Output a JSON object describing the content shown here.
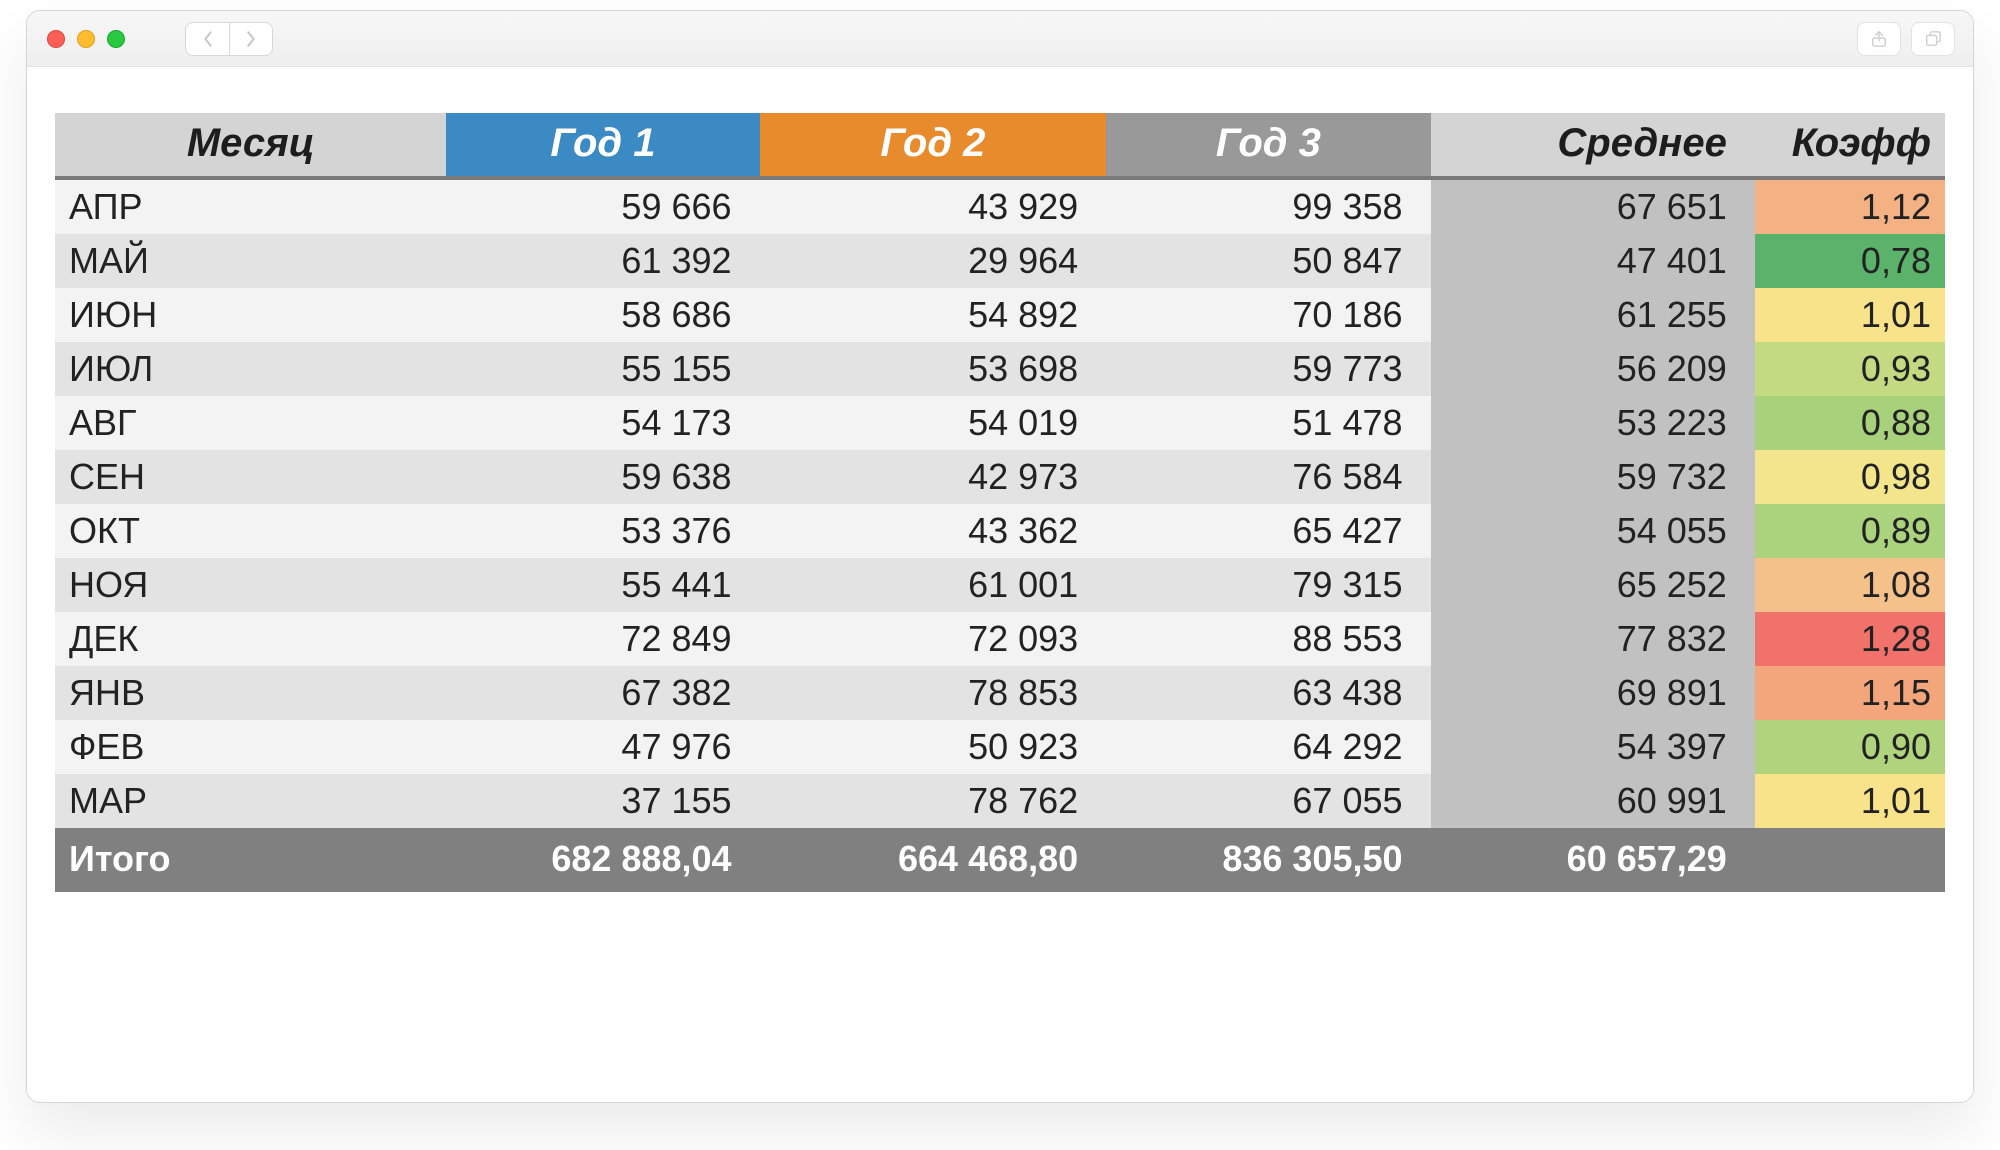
{
  "headers": {
    "month": "Месяц",
    "y1": "Год 1",
    "y2": "Год 2",
    "y3": "Год 3",
    "avg": "Среднее",
    "coef": "Коэфф"
  },
  "rows": [
    {
      "month": "АПР",
      "y1": "59 666",
      "y2": "43 929",
      "y3": "99 358",
      "avg": "67 651",
      "coef": "1,12",
      "coef_color": "#f4b183"
    },
    {
      "month": "МАЙ",
      "y1": "61 392",
      "y2": "29 964",
      "y3": "50 847",
      "avg": "47 401",
      "coef": "0,78",
      "coef_color": "#5bb26a"
    },
    {
      "month": "ИЮН",
      "y1": "58 686",
      "y2": "54 892",
      "y3": "70 186",
      "avg": "61 255",
      "coef": "1,01",
      "coef_color": "#f8e38a"
    },
    {
      "month": "ИЮЛ",
      "y1": "55 155",
      "y2": "53 698",
      "y3": "59 773",
      "avg": "56 209",
      "coef": "0,93",
      "coef_color": "#c3da82"
    },
    {
      "month": "АВГ",
      "y1": "54 173",
      "y2": "54 019",
      "y3": "51 478",
      "avg": "53 223",
      "coef": "0,88",
      "coef_color": "#a8d17c"
    },
    {
      "month": "СЕН",
      "y1": "59 638",
      "y2": "42 973",
      "y3": "76 584",
      "avg": "59 732",
      "coef": "0,98",
      "coef_color": "#f2e58b"
    },
    {
      "month": "ОКТ",
      "y1": "53 376",
      "y2": "43 362",
      "y3": "65 427",
      "avg": "54 055",
      "coef": "0,89",
      "coef_color": "#abd27d"
    },
    {
      "month": "НОЯ",
      "y1": "55 441",
      "y2": "61 001",
      "y3": "79 315",
      "avg": "65 252",
      "coef": "1,08",
      "coef_color": "#f4c18a"
    },
    {
      "month": "ДЕК",
      "y1": "72 849",
      "y2": "72 093",
      "y3": "88 553",
      "avg": "77 832",
      "coef": "1,28",
      "coef_color": "#f1716b"
    },
    {
      "month": "ЯНВ",
      "y1": "67 382",
      "y2": "78 853",
      "y3": "63 438",
      "avg": "69 891",
      "coef": "1,15",
      "coef_color": "#f3a57b"
    },
    {
      "month": "ФЕВ",
      "y1": "47 976",
      "y2": "50 923",
      "y3": "64 292",
      "avg": "54 397",
      "coef": "0,90",
      "coef_color": "#b0d47e"
    },
    {
      "month": "МАР",
      "y1": "37 155",
      "y2": "78 762",
      "y3": "67 055",
      "avg": "60 991",
      "coef": "1,01",
      "coef_color": "#f8e38a"
    }
  ],
  "footer": {
    "label": "Итого",
    "y1": "682 888,04",
    "y2": "664 468,80",
    "y3": "836 305,50",
    "avg": "60 657,29",
    "coef": ""
  },
  "chart_data": {
    "type": "table",
    "columns": [
      "Месяц",
      "Год 1",
      "Год 2",
      "Год 3",
      "Среднее",
      "Коэфф"
    ],
    "rows": [
      [
        "АПР",
        59666,
        43929,
        99358,
        67651,
        1.12
      ],
      [
        "МАЙ",
        61392,
        29964,
        50847,
        47401,
        0.78
      ],
      [
        "ИЮН",
        58686,
        54892,
        70186,
        61255,
        1.01
      ],
      [
        "ИЮЛ",
        55155,
        53698,
        59773,
        56209,
        0.93
      ],
      [
        "АВГ",
        54173,
        54019,
        51478,
        53223,
        0.88
      ],
      [
        "СЕН",
        59638,
        42973,
        76584,
        59732,
        0.98
      ],
      [
        "ОКТ",
        53376,
        43362,
        65427,
        54055,
        0.89
      ],
      [
        "НОЯ",
        55441,
        61001,
        79315,
        65252,
        1.08
      ],
      [
        "ДЕК",
        72849,
        72093,
        88553,
        77832,
        1.28
      ],
      [
        "ЯНВ",
        67382,
        78853,
        63438,
        69891,
        1.15
      ],
      [
        "ФЕВ",
        47976,
        50923,
        64292,
        54397,
        0.9
      ],
      [
        "МАР",
        37155,
        78762,
        67055,
        60991,
        1.01
      ]
    ],
    "totals": {
      "Год 1": 682888.04,
      "Год 2": 664468.8,
      "Год 3": 836305.5,
      "Среднее": 60657.29
    }
  }
}
